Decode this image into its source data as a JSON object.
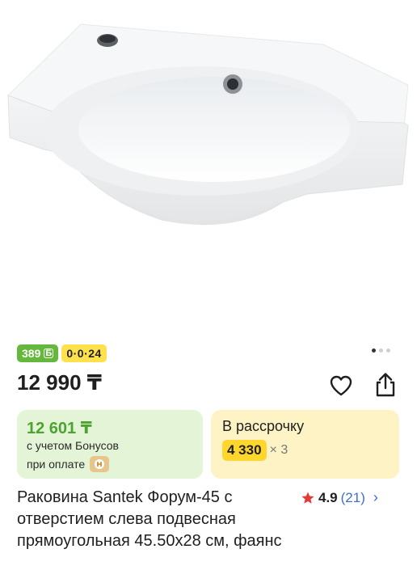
{
  "product_image": {
    "alt": "Раковина Santek Форум-45"
  },
  "badges": {
    "bonus": "389",
    "bonus_icon": "bonus-coin-icon",
    "installment": "0·0·24"
  },
  "gallery": {
    "total": 3,
    "active": 1
  },
  "price": "12 990 ₸",
  "bonus_card": {
    "price": "12 601 ₸",
    "note_line1": "с учетом Бонусов",
    "note_line2": "при оплате"
  },
  "installment_card": {
    "title": "В рассрочку",
    "amount": "4 330",
    "multiplier": "× 3"
  },
  "product": {
    "title": "Раковина Santek Форум-45 с отверстием слева подвесная прямоугольная 45.50x28 см, фаянс"
  },
  "rating": {
    "score": "4.9",
    "count": "(21)"
  },
  "colors": {
    "bonus_green": "#64b83c",
    "installment_yellow": "#ffe14d",
    "rating_star": "#e53935",
    "link_blue": "#3e6ed6"
  }
}
